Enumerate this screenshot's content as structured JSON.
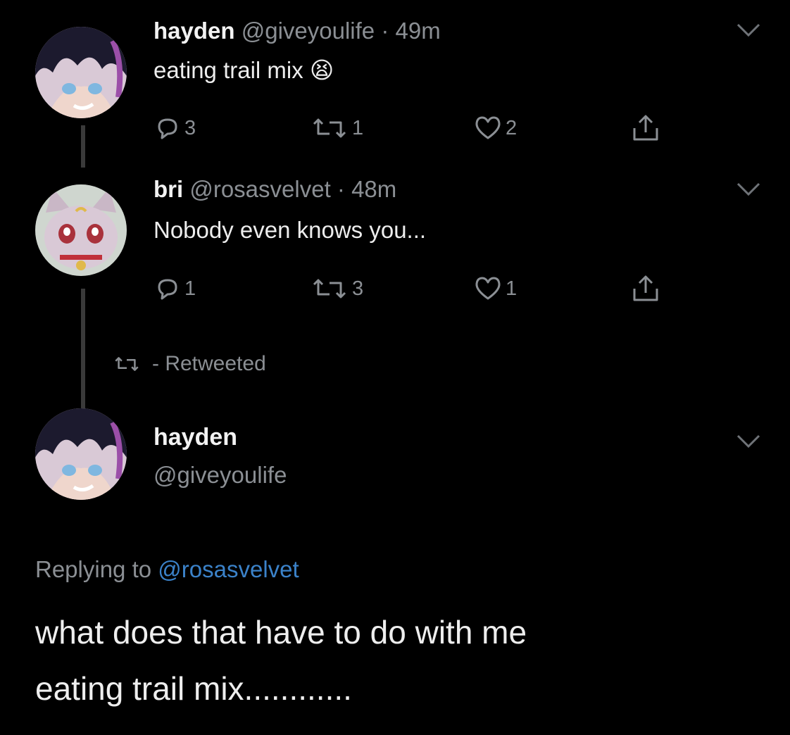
{
  "thread": [
    {
      "name": "hayden",
      "handle": "@giveyoulife",
      "time": "· 49m",
      "text": "eating trail mix",
      "emoji": "😫",
      "replies": "3",
      "retweets": "1",
      "likes": "2"
    },
    {
      "name": "bri",
      "handle": "@rosasvelvet",
      "time": "· 48m",
      "text": "Nobody even knows you...",
      "replies": "1",
      "retweets": "3",
      "likes": "1"
    }
  ],
  "retweeted_label": "- Retweeted",
  "main_tweet": {
    "name": "hayden",
    "handle": "@giveyoulife",
    "replying_prefix": "Replying to",
    "replying_to": "@rosasvelvet",
    "text_line1": "what does that have to do with me",
    "text_line2": "eating trail mix............"
  },
  "icons": {
    "reply": "reply-icon",
    "retweet": "retweet-icon",
    "like": "heart-icon",
    "share": "share-icon",
    "more": "chevron-down-icon"
  },
  "colors": {
    "background": "#000000",
    "muted": "#8b8f94",
    "link": "#3b82c9"
  }
}
